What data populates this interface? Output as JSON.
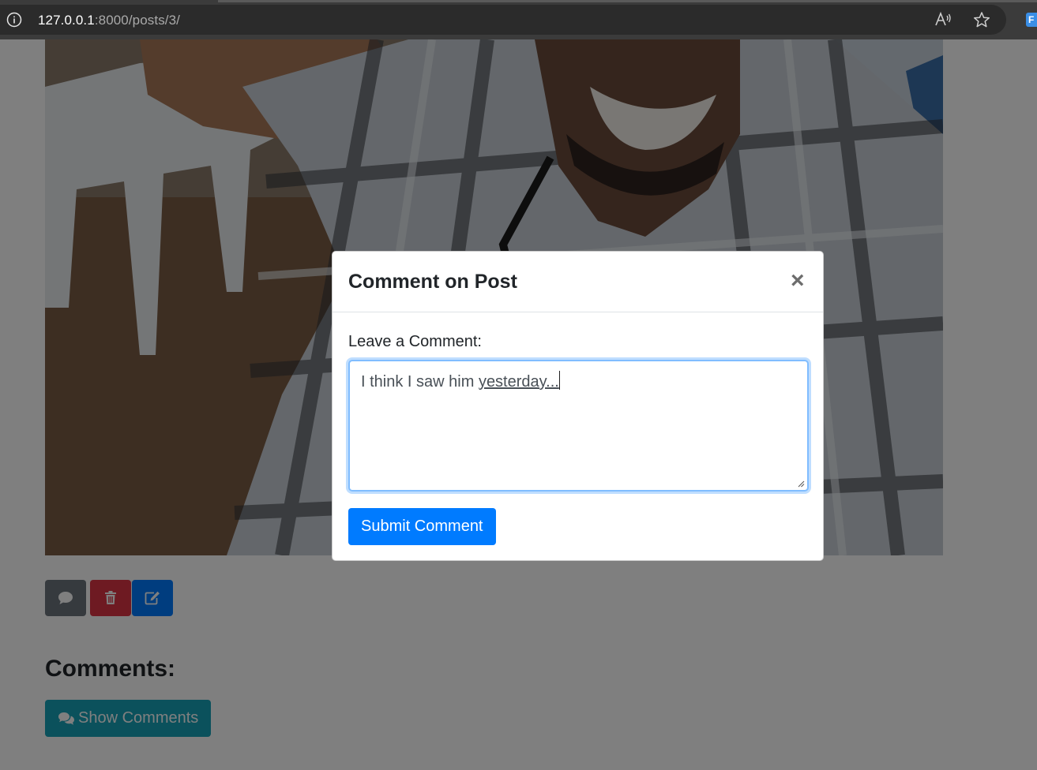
{
  "browser": {
    "url_host": "127.0.0.1",
    "url_path": ":8000/posts/3/",
    "icons": [
      "info-icon",
      "read-aloud-icon",
      "favorite-star-icon",
      "extension-icon"
    ],
    "extension_label": "F"
  },
  "post": {
    "photo": "selfie-photo",
    "action_icons": [
      "comment-icon",
      "trash-icon",
      "edit-icon"
    ],
    "colors": {
      "comment": "#6c757d",
      "delete": "#dc3545",
      "edit": "#007bff"
    }
  },
  "comments": {
    "title": "Comments:",
    "show_button_label": "Show Comments",
    "show_button_color": "#17a2b8"
  },
  "modal": {
    "title": "Comment on Post",
    "close_glyph": "×",
    "field_label": "Leave a Comment:",
    "textarea_value_plain": "I think I saw him ",
    "textarea_value_flagged": "yesterday...",
    "submit_label": "Submit Comment",
    "accent": "#007bff"
  }
}
